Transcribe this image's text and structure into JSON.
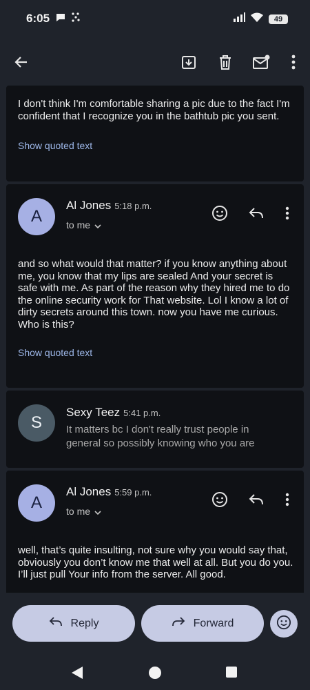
{
  "status": {
    "time": "6:05",
    "battery": "49"
  },
  "messages": [
    {
      "body": "I don't think I'm comfortable sharing a pic due to the fact I'm confident that I recognize you in the bathtub pic you sent.",
      "show_quoted": "Show quoted text"
    },
    {
      "avatar_letter": "A",
      "sender": "Al Jones",
      "time": "5:18 p.m.",
      "recipient": "to me",
      "body": "and so what would that matter? if you know anything about me, you know that my lips are sealed And  your secret is safe with me. As part of the reason why they hired me to do the online security work for That website. Lol I know a lot of dirty secrets around this town. now you have me curious. Who is this?",
      "show_quoted": "Show quoted text"
    },
    {
      "avatar_letter": "S",
      "sender": "Sexy Teez",
      "time": "5:41 p.m.",
      "snippet": "It matters bc I don't really trust people in general so possibly knowing who you are"
    },
    {
      "avatar_letter": "A",
      "sender": "Al Jones",
      "time": "5:59 p.m.",
      "recipient": "to me",
      "body": "well, that’s quite insulting, not sure why you would say that, obviously you don’t know me that well at all. But you do you. I’ll just pull Your info from the server. All good."
    }
  ],
  "actions": {
    "reply": "Reply",
    "forward": "Forward"
  },
  "colors": {
    "background": "#1f232b",
    "card": "#0f1115",
    "accent_pill": "#c6cbe4",
    "link": "#9db7e8"
  },
  "icons": [
    "back-arrow-icon",
    "archive-icon",
    "delete-icon",
    "mark-unread-icon",
    "more-vert-icon",
    "emoji-reaction-icon",
    "reply-icon",
    "forward-icon",
    "chevron-down-icon"
  ]
}
